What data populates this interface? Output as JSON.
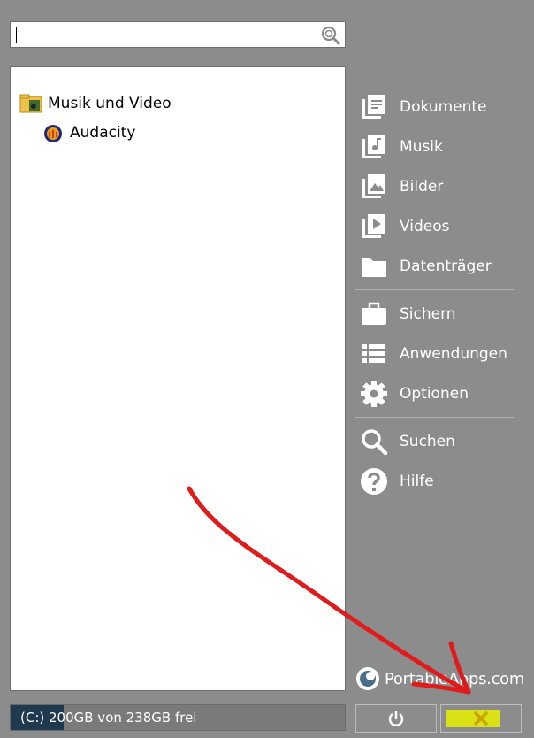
{
  "search": {
    "value": "",
    "placeholder": "",
    "icon": "search-icon"
  },
  "tree": {
    "folder": {
      "label": "Musik und Video",
      "icon": "folder-media-icon"
    },
    "apps": [
      {
        "label": "Audacity",
        "icon": "audacity-icon"
      }
    ]
  },
  "nav": {
    "items": [
      {
        "label": "Dokumente",
        "icon": "documents-icon"
      },
      {
        "label": "Musik",
        "icon": "music-icon"
      },
      {
        "label": "Bilder",
        "icon": "pictures-icon"
      },
      {
        "label": "Videos",
        "icon": "videos-icon"
      },
      {
        "label": "Datenträger",
        "icon": "folder-icon"
      },
      {
        "label": "Sichern",
        "icon": "briefcase-icon"
      },
      {
        "label": "Anwendungen",
        "icon": "list-icon"
      },
      {
        "label": "Optionen",
        "icon": "gear-icon"
      },
      {
        "label": "Suchen",
        "icon": "search-icon"
      },
      {
        "label": "Hilfe",
        "icon": "help-icon"
      }
    ]
  },
  "brand": {
    "label": "PortableApps.com"
  },
  "status": {
    "text": "(C:) 200GB von 238GB frei",
    "used_fraction": 0.16
  },
  "buttons": {
    "power": "power-icon",
    "close": "close-icon"
  },
  "colors": {
    "background": "#8c8c8c",
    "annotation": "#e01b1b",
    "highlight": "#e8f000"
  }
}
